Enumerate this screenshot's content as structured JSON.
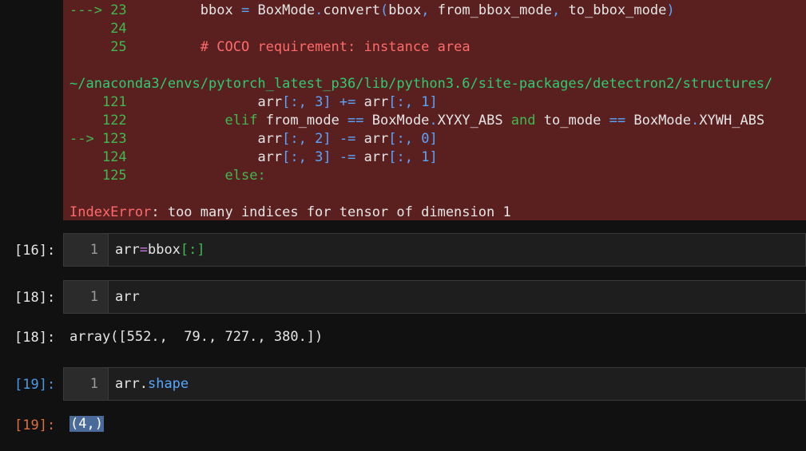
{
  "traceback": {
    "lines": [
      {
        "marker": "---> ",
        "lineno": "23",
        "code": "        bbox = BoxMode.convert(bbox, from_bbox_mode, to_bbox_mode)"
      },
      {
        "marker": "     ",
        "lineno": "24",
        "code": ""
      },
      {
        "marker": "     ",
        "lineno": "25",
        "code": "        # COCO requirement: instance area"
      },
      {
        "path": "~/anaconda3/envs/pytorch_latest_p36/lib/python3.6/site-packages/detectron2/structures/"
      },
      {
        "marker": "    ",
        "lineno": "121",
        "code": "                arr[:, 3] += arr[:, 1]"
      },
      {
        "marker": "    ",
        "lineno": "122",
        "code": "            elif from_mode == BoxMode.XYXY_ABS and to_mode == BoxMode.XYWH_ABS"
      },
      {
        "marker": "--> ",
        "lineno": "123",
        "code": "                arr[:, 2] -= arr[:, 0]"
      },
      {
        "marker": "    ",
        "lineno": "124",
        "code": "                arr[:, 3] -= arr[:, 1]"
      },
      {
        "marker": "    ",
        "lineno": "125",
        "code": "            else:"
      }
    ],
    "error_type": "IndexError",
    "error_message": ": too many indices for tensor of dimension 1"
  },
  "cells": [
    {
      "prompt": "[16]:",
      "line_no": "1",
      "code_a": "arr",
      "code_b": "=",
      "code_c": "bbox",
      "code_d": "[:]"
    },
    {
      "prompt": "[18]:",
      "line_no": "1",
      "code": "arr"
    },
    {
      "out_prompt": "[18]:",
      "output": "array([552.,  79., 727., 380.])"
    },
    {
      "prompt": "[19]:",
      "line_no": "1",
      "code_a": "arr",
      "code_b": ".",
      "code_c": "shape"
    },
    {
      "out_prompt": "[19]:",
      "output": "(4,)"
    }
  ]
}
